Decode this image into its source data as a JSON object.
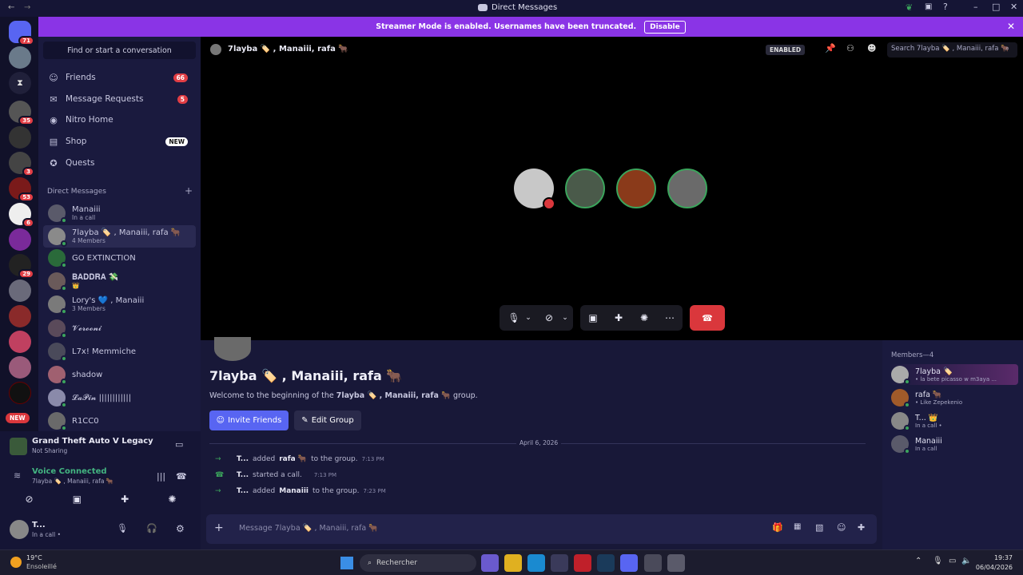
{
  "window": {
    "title": "Direct Messages"
  },
  "banner": {
    "text": "Streamer Mode is enabled. Usernames have been truncated.",
    "disable_label": "Disable"
  },
  "guilds": {
    "badges": [
      "71",
      "35",
      "3",
      "53",
      "6",
      "29"
    ],
    "new_label": "NEW"
  },
  "sidebar": {
    "search_placeholder": "Find or start a conversation",
    "nav": [
      {
        "label": "Friends",
        "badge": "66"
      },
      {
        "label": "Message Requests",
        "badge": "5"
      },
      {
        "label": "Nitro Home"
      },
      {
        "label": "Shop",
        "badge": "NEW"
      },
      {
        "label": "Quests"
      }
    ],
    "dm_header": "Direct Messages",
    "dms": [
      {
        "name": "Manaiii",
        "sub": "In a call"
      },
      {
        "name": "7layba 🏷️ , Manaiii, rafa 🐂",
        "sub": "4 Members"
      },
      {
        "name": "GO EXTINCTION",
        "sub": ""
      },
      {
        "name": "𝐁𝐀𝐃𝐃𝐑𝐀 💸",
        "sub": "👑"
      },
      {
        "name": "Lory's 💙 , Manaiii",
        "sub": "3 Members"
      },
      {
        "name": "𝓥𝓮𝓻𝓸𝓸𝓷𝓲",
        "sub": ""
      },
      {
        "name": "L7x! Memmiche",
        "sub": ""
      },
      {
        "name": "shadow",
        "sub": ""
      },
      {
        "name": "𝓛𝓪𝓟𝓲𝓷 ||||||||||||",
        "sub": ""
      },
      {
        "name": "R1CC0",
        "sub": ""
      }
    ]
  },
  "activity": {
    "game": "Grand Theft Auto V Legacy",
    "status": "Not Sharing"
  },
  "voice": {
    "title": "Voice Connected",
    "channel": "7layba 🏷️ , Manaiii, rafa 🐂"
  },
  "user": {
    "name": "T...",
    "status": "In a call •"
  },
  "header": {
    "channel": "7layba 🏷️ , Manaiii, rafa 🐂",
    "enabled_label": "ENABLED",
    "search_placeholder": "Search 7layba 🏷️ , Manaiii, rafa 🐂"
  },
  "chat": {
    "title": "7layba 🏷️ , Manaiii, rafa 🐂",
    "welcome_pre": "Welcome to the beginning of the",
    "welcome_group": "7layba 🏷️ , Manaiii, rafa 🐂",
    "welcome_post": "group.",
    "invite_label": "Invite Friends",
    "edit_label": "Edit Group",
    "date": "April 6, 2026",
    "events": [
      {
        "actor": "T...",
        "action": "added",
        "target": "rafa 🐂",
        "rest": "to the group.",
        "time": "7:13 PM"
      },
      {
        "actor": "T...",
        "action": "started a call.",
        "target": "",
        "rest": "",
        "time": "7:13 PM"
      },
      {
        "actor": "T...",
        "action": "added",
        "target": "Manaiii",
        "rest": "to the group.",
        "time": "7:23 PM"
      }
    ],
    "input_placeholder": "Message 7layba 🏷️ , Manaiii, rafa 🐂"
  },
  "members": {
    "header": "Members—4",
    "list": [
      {
        "name": "7layba 🏷️",
        "sub": "• la bete picasso w m3aya ..."
      },
      {
        "name": "rafa 🐂",
        "sub": "• Like Zepekenio"
      },
      {
        "name": "T... 👑",
        "sub": "In a call •"
      },
      {
        "name": "Manaiii",
        "sub": "In a call"
      }
    ]
  },
  "taskbar": {
    "weather_temp": "19°C",
    "weather_desc": "Ensoleillé",
    "search_label": "Rechercher",
    "time": "19:37",
    "date": "06/04/2026"
  },
  "colors": {
    "accent": "#5865f2",
    "banner": "#8a34e6",
    "danger": "#da373c",
    "online": "#3ba55c"
  }
}
